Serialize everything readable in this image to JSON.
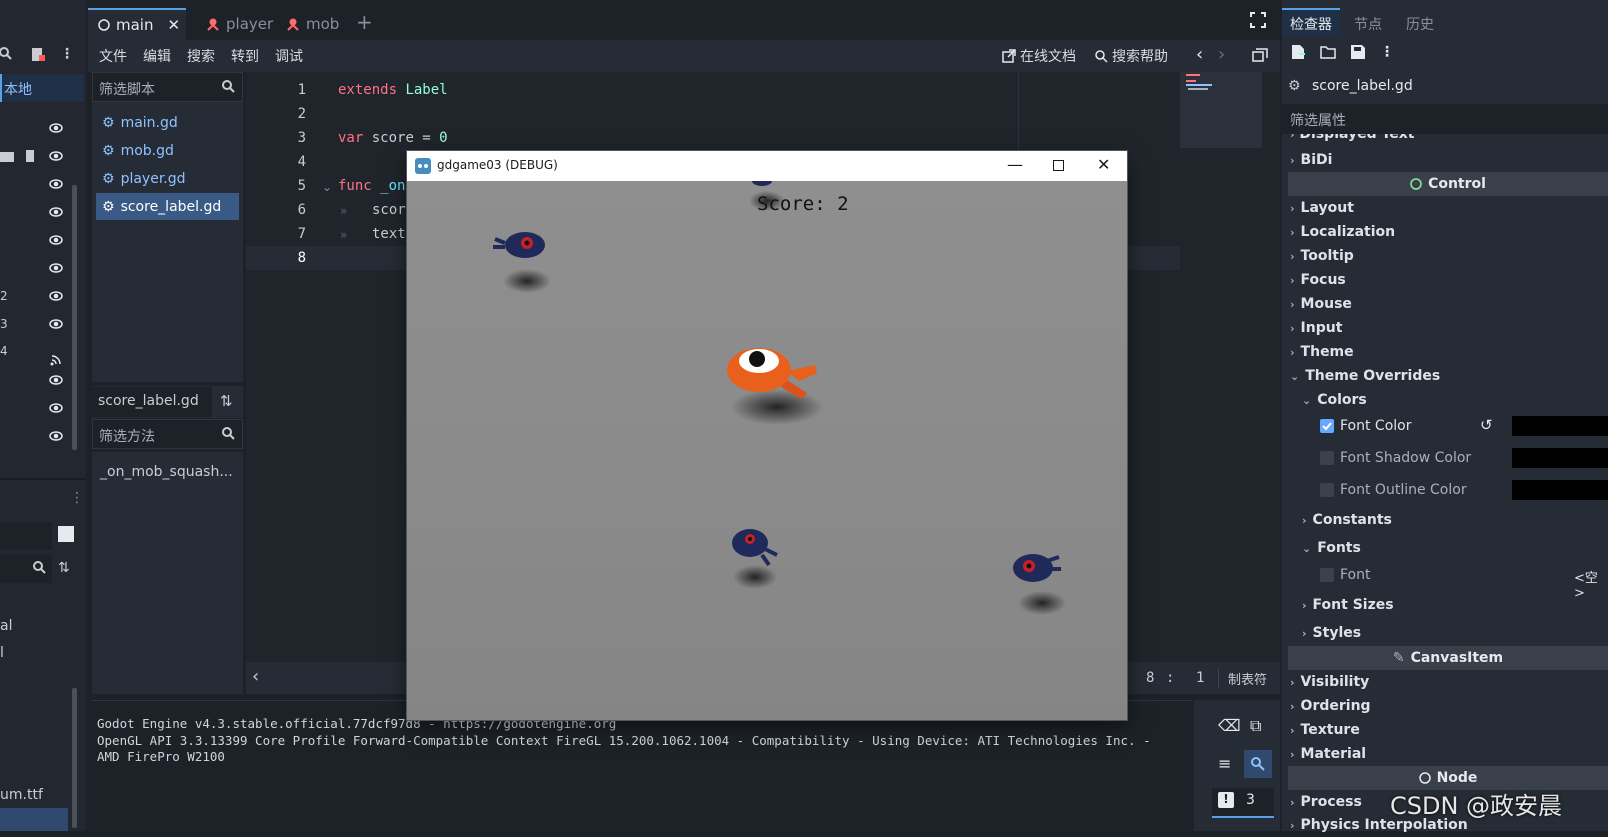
{
  "left_dock": {
    "local_label": "本地",
    "partial_labels": [
      "2",
      "3",
      "4",
      "al",
      "l",
      "um.ttf"
    ]
  },
  "tabs": [
    {
      "label": "main"
    },
    {
      "label": "player"
    },
    {
      "label": "mob"
    }
  ],
  "menu": {
    "items": [
      "文件",
      "编辑",
      "搜索",
      "转到",
      "调试"
    ],
    "online_docs": "在线文档",
    "search_help": "搜索帮助"
  },
  "script_panel": {
    "filter_placeholder": "筛选脚本",
    "scripts": [
      "main.gd",
      "mob.gd",
      "player.gd",
      "score_label.gd"
    ],
    "current_script": "score_label.gd",
    "filter_methods_placeholder": "筛选方法",
    "methods": [
      "_on_mob_squash..."
    ]
  },
  "editor": {
    "line_numbers": [
      "1",
      "2",
      "3",
      "4",
      "5",
      "6",
      "7",
      "8"
    ],
    "lines": {
      "l1_kw": "extends",
      "l1_cls": "Label",
      "l3_kw": "var",
      "l3_rest": " score = ",
      "l3_num": "0",
      "l5_kw": "func",
      "l5_rest": " _on",
      "l6": "scor",
      "l7": "text"
    },
    "cursor_line": "8",
    "cursor_col": "1",
    "indent_mode": "制表符"
  },
  "output": {
    "lines": [
      "Godot Engine v4.3.stable.official.77dcf97d8 - https://godotengine.org",
      "OpenGL API 3.3.13399 Core Profile Forward-Compatible Context FireGL 15.200.1062.1004 - Compatibility - Using Device: ATI Technologies Inc. -",
      "AMD FirePro W2100"
    ],
    "error_count": "3"
  },
  "inspector": {
    "tabs": [
      "检查器",
      "节点",
      "历史"
    ],
    "resource": "score_label.gd",
    "filter_placeholder": "筛选属性",
    "partial_top": "Displayed Text",
    "bidi": "BiDi",
    "control_header": "Control",
    "control_groups": [
      "Layout",
      "Localization",
      "Tooltip",
      "Focus",
      "Mouse",
      "Input",
      "Theme",
      "Theme Overrides"
    ],
    "colors_label": "Colors",
    "color_props": [
      {
        "label": "Font Color",
        "checked": true
      },
      {
        "label": "Font Shadow Color",
        "checked": false
      },
      {
        "label": "Font Outline Color",
        "checked": false
      }
    ],
    "constants_label": "Constants",
    "fonts_label": "Fonts",
    "font_prop": "Font",
    "font_value": "<空>",
    "font_sizes_label": "Font Sizes",
    "styles_label": "Styles",
    "canvas_header": "CanvasItem",
    "canvas_groups": [
      "Visibility",
      "Ordering",
      "Texture",
      "Material"
    ],
    "node_header": "Node",
    "node_groups": [
      "Process",
      "Physics Interpolation"
    ]
  },
  "game_window": {
    "title": "gdgame03 (DEBUG)",
    "score_text": "Score: 2"
  },
  "watermark": "CSDN @政安晨",
  "colors": {
    "accent": "#5aa0e6",
    "keyword": "#ff7085",
    "class": "#8effda",
    "player": "#e8601c",
    "mob": "#1f2a5a"
  }
}
